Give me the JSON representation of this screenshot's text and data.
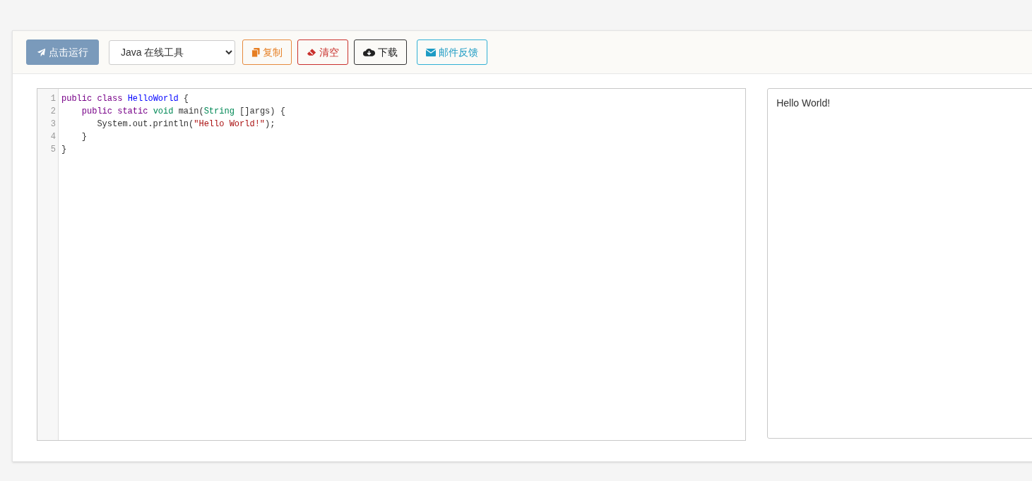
{
  "toolbar": {
    "buttons": [
      {
        "kind": "run",
        "label": "点击运行"
      },
      {
        "kind": "select",
        "label": "Java 在线工具"
      },
      {
        "kind": "copy",
        "label": "复制"
      },
      {
        "kind": "clear",
        "label": "清空"
      },
      {
        "kind": "download",
        "label": "下载"
      },
      {
        "kind": "mail",
        "label": "邮件反馈"
      }
    ]
  },
  "editor": {
    "lines": [
      {
        "number": "1",
        "tokens": [
          {
            "text": "public class ",
            "kind": "keyword"
          },
          {
            "text": "HelloWorld",
            "kind": "def"
          },
          {
            "text": " {",
            "kind": "plain"
          }
        ]
      },
      {
        "number": "2",
        "tokens": [
          {
            "text": "    public static ",
            "kind": "keyword"
          },
          {
            "text": "void",
            "kind": "type"
          },
          {
            "text": " main(",
            "kind": "plain"
          },
          {
            "text": "String",
            "kind": "type"
          },
          {
            "text": " []args) {",
            "kind": "plain"
          }
        ]
      },
      {
        "number": "3",
        "tokens": [
          {
            "text": "       System.out.println(",
            "kind": "plain"
          },
          {
            "text": "\"Hello World!\"",
            "kind": "string"
          },
          {
            "text": ");",
            "kind": "plain"
          }
        ]
      },
      {
        "number": "4",
        "tokens": [
          {
            "text": "    }",
            "kind": "plain"
          }
        ]
      },
      {
        "number": "5",
        "tokens": [
          {
            "text": "}",
            "kind": "plain"
          }
        ]
      }
    ]
  },
  "output": {
    "text": "Hello World!"
  }
}
